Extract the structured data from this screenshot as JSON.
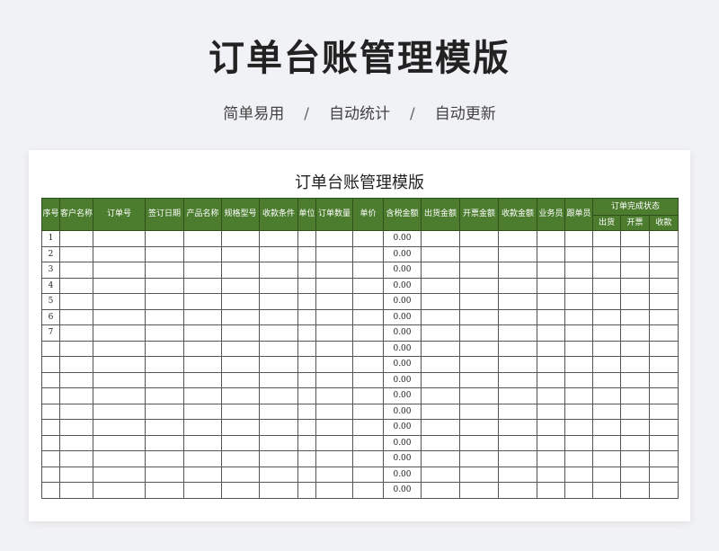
{
  "hero": {
    "title": "订单台账管理模版",
    "tags": [
      "简单易用",
      "自动统计",
      "自动更新"
    ],
    "separator": "/"
  },
  "sheet": {
    "title": "订单台账管理模版",
    "header_color": "#4c7d2f",
    "columns": [
      "序号",
      "客户名称",
      "订单号",
      "签订日期",
      "产品名称",
      "规格型号",
      "收款条件",
      "单位",
      "订单数量",
      "单价",
      "含税金额",
      "出货金额",
      "开票金额",
      "收款金额",
      "业务员",
      "跟单员"
    ],
    "group_header": "订单完成状态",
    "sub_columns": [
      "出货",
      "开票",
      "收款"
    ],
    "row_count": 17,
    "serials": [
      "1",
      "2",
      "3",
      "4",
      "5",
      "6",
      "7"
    ],
    "tax_amount_default": "0.00"
  }
}
